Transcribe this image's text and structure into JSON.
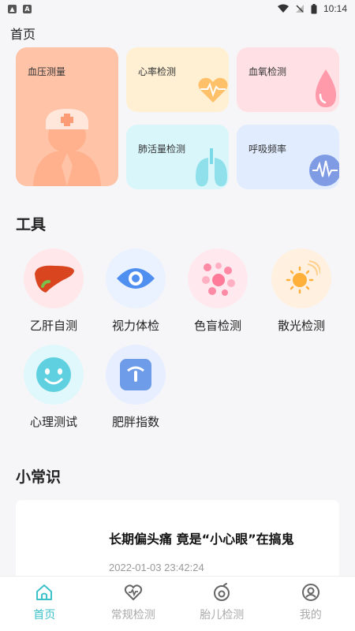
{
  "status": {
    "time": "10:14"
  },
  "page_title": "首页",
  "cards": {
    "blood_pressure": "血压测量",
    "heart_rate": "心率检测",
    "blood_oxygen": "血氧检测",
    "lung_capacity": "肺活量检测",
    "respiration": "呼吸频率"
  },
  "tools_section": {
    "title": "工具",
    "items": [
      {
        "label": "乙肝自测",
        "icon": "liver-icon"
      },
      {
        "label": "视力体检",
        "icon": "eye-icon"
      },
      {
        "label": "色盲检测",
        "icon": "color-dots-icon"
      },
      {
        "label": "散光检测",
        "icon": "sun-icon"
      },
      {
        "label": "心理测试",
        "icon": "smiley-icon"
      },
      {
        "label": "肥胖指数",
        "icon": "scale-icon"
      }
    ]
  },
  "knowledge_section": {
    "title": "小常识",
    "articles": [
      {
        "title": "长期偏头痛 竟是“小心眼”在搞鬼",
        "time": "2022-01-03 23:42:24"
      }
    ]
  },
  "tabbar": {
    "items": [
      {
        "label": "首页",
        "icon": "home-icon"
      },
      {
        "label": "常规检测",
        "icon": "heart-check-icon"
      },
      {
        "label": "胎儿检测",
        "icon": "fetus-icon"
      },
      {
        "label": "我的",
        "icon": "profile-icon"
      }
    ],
    "active_color": "#3cc2c9"
  }
}
